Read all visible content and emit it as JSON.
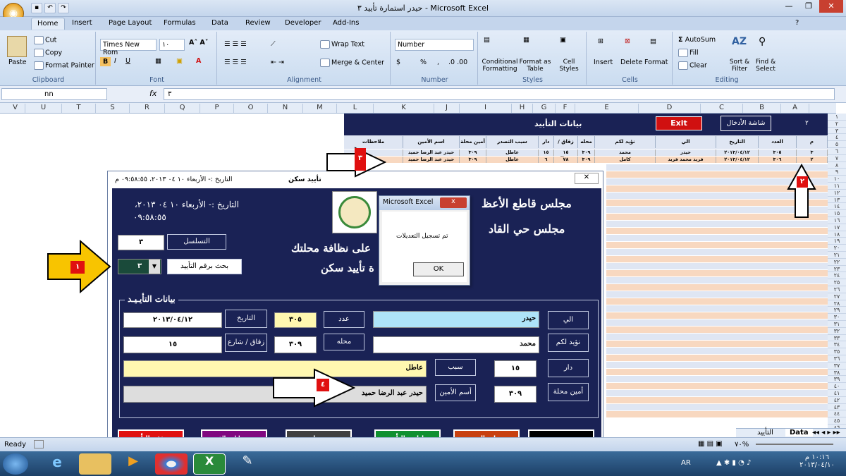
{
  "window": {
    "title": "حيدر استمارة تأييد ٣ - Microsoft Excel",
    "office_icon": "office-logo",
    "qat_icons": [
      "save-icon",
      "undo-icon",
      "redo-icon"
    ]
  },
  "tabs": [
    "Home",
    "Insert",
    "Page Layout",
    "Formulas",
    "Data",
    "Review",
    "Developer",
    "Add-Ins"
  ],
  "ribbon": {
    "clipboard": {
      "label": "Clipboard",
      "paste": "Paste",
      "cut": "Cut",
      "copy": "Copy",
      "format_painter": "Format Painter"
    },
    "font": {
      "label": "Font",
      "family": "Times New Rom",
      "size": "١٠"
    },
    "alignment": {
      "label": "Alignment",
      "wrap": "Wrap Text",
      "merge": "Merge & Center"
    },
    "number": {
      "label": "Number",
      "format": "Number",
      "pct": "%",
      "comma": ","
    },
    "styles": {
      "label": "Styles",
      "cond": "Conditional Formatting",
      "table": "Format as Table",
      "cell": "Cell Styles"
    },
    "cells": {
      "label": "Cells",
      "insert": "Insert",
      "delete": "Delete",
      "format": "Format"
    },
    "editing": {
      "label": "Editing",
      "autosum": "AutoSum",
      "fill": "Fill",
      "clear": "Clear",
      "sort": "Sort & Filter",
      "find": "Find & Select"
    }
  },
  "formula_bar": {
    "name_box": "nn",
    "fx": "fx",
    "value": "٣"
  },
  "columns": [
    "V",
    "U",
    "T",
    "S",
    "R",
    "Q",
    "P",
    "O",
    "N",
    "M",
    "L",
    "K",
    "J",
    "I",
    "H",
    "G",
    "F",
    "E",
    "D",
    "C",
    "B",
    "A"
  ],
  "rows": [
    "١",
    "٢",
    "٣",
    "٤",
    "٥",
    "٦",
    "٧",
    "٨",
    "٩",
    "١٠",
    "١١",
    "١٢",
    "١٣",
    "١٤",
    "١٥",
    "١٦",
    "١٧",
    "١٨",
    "١٩",
    "٢٠",
    "٢١",
    "٢٢",
    "٢٣",
    "٢٤",
    "٢٥",
    "٢٦",
    "٢٧",
    "٢٨",
    "٢٩",
    "٣٠",
    "٣١",
    "٣٢",
    "٣٣",
    "٣٤",
    "٣٥",
    "٣٦",
    "٣٧",
    "٣٨",
    "٣٩",
    "٤٠",
    "٤١",
    "٤٢",
    "٤٣",
    "٤٤",
    "٤٥",
    "٤٦"
  ],
  "data_sheet": {
    "title": "بيانات التأييد",
    "exit": "Exit",
    "input_screen": "شاشة الأدخال",
    "row_no": "٢",
    "headers": [
      "م",
      "العدد",
      "التاريخ",
      "الي",
      "نؤيد لكم",
      "محله",
      "زقاق / شارع",
      "دار",
      "سبب التصدر",
      "أمين محلة",
      "اسم الأمين",
      "ملاحظات"
    ],
    "rows": [
      [
        "٣",
        "٣٠٥",
        "٢٠١٣/٠٤/١٢",
        "حيدر",
        "محمد",
        "٣٠٩",
        "١٥",
        "١٥",
        "عاطل",
        "٣٠٩",
        "حيدر عبد الرضا حميد",
        ""
      ],
      [
        "٢",
        "٣٠٦",
        "٢٠١٣/٠٤/١٢",
        "فريد محمد فريد",
        "كامل",
        "٣٠٩",
        "٧٨",
        "٦",
        "عاطل",
        "٣٠٩",
        "حيدر عبد الرضا حميد",
        ""
      ]
    ]
  },
  "form": {
    "header_date": "التاريخ :- الأربعاء   ١٠ ٠٤ ٢٠١٣، ٠٩:٥٨:٥٥ م",
    "header_title": "تأييد سكن",
    "date_line1": "التاريخ :- الأربعاء ١٠ ٠٤ ٢٠١٣،",
    "date_line2": "٠٩:٥٨:٥٥",
    "council1": "مجلس قاطع الأعظ",
    "council2": "مجلس حي القاد",
    "slogan": "على نظافة محلتك",
    "form_name": "ة تأييد سكن",
    "serial_label": "التسلسل",
    "serial_value": "٣",
    "search_label": "بحث برقم التأييد",
    "search_value": "٣",
    "section_title": "بيانات التأيـيـد",
    "to_label": "الي",
    "to_value": "حيدر",
    "num_label": "عدد",
    "num_value": "٣٠٥",
    "date_label": "التاريخ",
    "date_value": "٢٠١٣/٠٤/١٢",
    "confirm_label": "نؤيد لكم",
    "confirm_value": "محمد",
    "mahala_label": "محله",
    "mahala_value": "٣٠٩",
    "alley_label": "زقاق / شارع",
    "alley_value": "١٥",
    "house_label": "دار",
    "house_value": "١٥",
    "reason_label": "سبب",
    "reason_value": "عاطل",
    "amin_label": "أمين محلة",
    "amin_value": "٣٠٩",
    "amin_name_label": "أسم الأمين",
    "amin_name_value": "حيدر عبد الرضا حميد",
    "buttons": {
      "exit": "خروج",
      "enter": "ادخال",
      "print": "طباعة التأييد",
      "edit": "تعديل",
      "clear": "مسح بيانات الفورم",
      "delete": "حذف التأييد"
    }
  },
  "msgbox": {
    "title": "Microsoft Excel",
    "message": "تم تسجيل التعديلات",
    "ok": "OK",
    "close": "x"
  },
  "annotations": {
    "one": "١",
    "two": "٢",
    "three": "٣",
    "four": "٤"
  },
  "status": {
    "ready": "Ready",
    "zoom": "٧٠%",
    "sheet_active": "Data",
    "sheet_other": "التأييد"
  },
  "taskbar": {
    "lang": "AR",
    "time": "١٠:١٦ م",
    "date": "٢٠١٣/٠٤/١٠"
  }
}
